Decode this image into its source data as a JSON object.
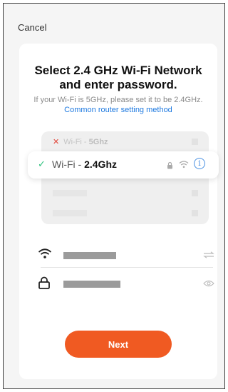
{
  "header": {
    "cancel_label": "Cancel"
  },
  "title": {
    "line1": "Select 2.4 GHz Wi-Fi Network",
    "line2": "and enter password."
  },
  "subtitle": {
    "text": "If your Wi-Fi is 5GHz, please set it to be 2.4GHz.",
    "link": "Common router setting method"
  },
  "networks": {
    "unsupported": {
      "prefix": "Wi-Fi - ",
      "band": "5Ghz",
      "status_icon": "cross-icon"
    },
    "supported": {
      "prefix": "Wi-Fi - ",
      "band": "2.4Ghz",
      "status_icon": "check-icon"
    }
  },
  "form": {
    "ssid_icon": "wifi-icon",
    "password_icon": "lock-icon",
    "switch_icon": "swap-arrows-icon",
    "visibility_icon": "eye-icon"
  },
  "actions": {
    "next_label": "Next"
  },
  "colors": {
    "accent": "#f05a22",
    "link": "#1f7ae0",
    "check": "#2ec27e",
    "cross": "#e2473b"
  }
}
